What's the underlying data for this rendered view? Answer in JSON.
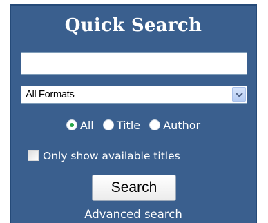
{
  "widget": {
    "title": "Quick Search",
    "search_input": {
      "value": "",
      "placeholder": ""
    },
    "format_select": {
      "selected": "All Formats"
    },
    "radio_options": [
      {
        "label": "All",
        "checked": true
      },
      {
        "label": "Title",
        "checked": false
      },
      {
        "label": "Author",
        "checked": false
      }
    ],
    "available_checkbox": {
      "label": "Only show available titles",
      "checked": false
    },
    "search_button_label": "Search",
    "advanced_link": "Advanced search"
  },
  "colors": {
    "panel_background": "#3a5f8e",
    "panel_border": "#254a78",
    "radio_selected_dot": "#2aa84a",
    "text": "#ffffff"
  },
  "icons": {
    "dropdown": "chevron-down-icon"
  }
}
